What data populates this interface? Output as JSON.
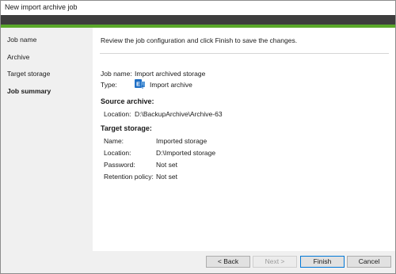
{
  "window": {
    "title": "New import archive job"
  },
  "sidebar": {
    "items": [
      {
        "label": "Job name"
      },
      {
        "label": "Archive"
      },
      {
        "label": "Target storage"
      },
      {
        "label": "Job summary"
      }
    ]
  },
  "main": {
    "intro": "Review the job configuration and click Finish to save the changes.",
    "job_name_label": "Job name:",
    "job_name_value": "Import archived storage",
    "type_label": "Type:",
    "type_value": "Import archive",
    "type_icon": "exchange-import-icon",
    "source": {
      "heading": "Source archive:",
      "location_label": "Location:",
      "location_value": "D:\\BackupArchive\\Archive-63"
    },
    "target": {
      "heading": "Target storage:",
      "name_label": "Name:",
      "name_value": "Imported storage",
      "location_label": "Location:",
      "location_value": "D:\\Imported storage",
      "password_label": "Password:",
      "password_value": "Not set",
      "retention_label": "Retention policy:",
      "retention_value": "Not set"
    }
  },
  "footer": {
    "back": "< Back",
    "next": "Next >",
    "finish": "Finish",
    "cancel": "Cancel"
  },
  "colors": {
    "accent_green": "#5aa82a",
    "header_dark": "#3d3d3d",
    "icon_blue": "#1f6fc5"
  }
}
